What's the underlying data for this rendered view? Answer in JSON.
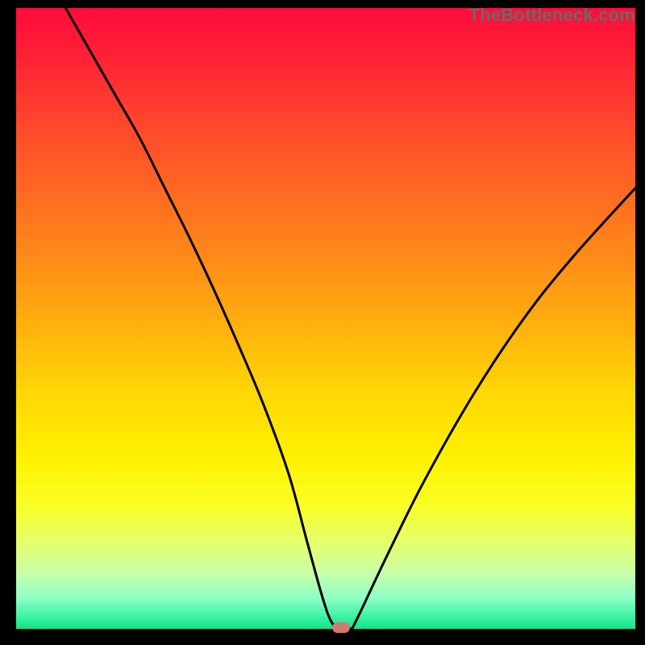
{
  "watermark": "TheBottleneck.com",
  "chart_data": {
    "type": "line",
    "title": "",
    "xlabel": "",
    "ylabel": "",
    "xlim": [
      0,
      100
    ],
    "ylim": [
      0,
      100
    ],
    "grid": false,
    "legend": false,
    "series": [
      {
        "name": "bottleneck-curve",
        "x": [
          8,
          12,
          16,
          20,
          24,
          28,
          32,
          36,
          40,
          44,
          47,
          49.5,
          51,
          52.5,
          54,
          55,
          60,
          66,
          74,
          82,
          90,
          100
        ],
        "y": [
          100,
          93,
          86,
          79,
          71,
          63,
          54.5,
          45.5,
          36,
          25,
          14,
          5,
          1,
          0,
          0,
          1.5,
          12,
          24,
          38,
          50,
          60,
          71
        ]
      }
    ],
    "marker": {
      "x": 52.5,
      "y": 0,
      "shape": "pill",
      "color": "#cf7a6e"
    },
    "background_gradient": {
      "direction": "top-to-bottom",
      "stops": [
        {
          "pos": 0,
          "color": "#ff0d3a"
        },
        {
          "pos": 30,
          "color": "#ff6a22"
        },
        {
          "pos": 62,
          "color": "#ffd706"
        },
        {
          "pos": 86,
          "color": "#e6ff6c"
        },
        {
          "pos": 100,
          "color": "#14e28c"
        }
      ]
    }
  }
}
